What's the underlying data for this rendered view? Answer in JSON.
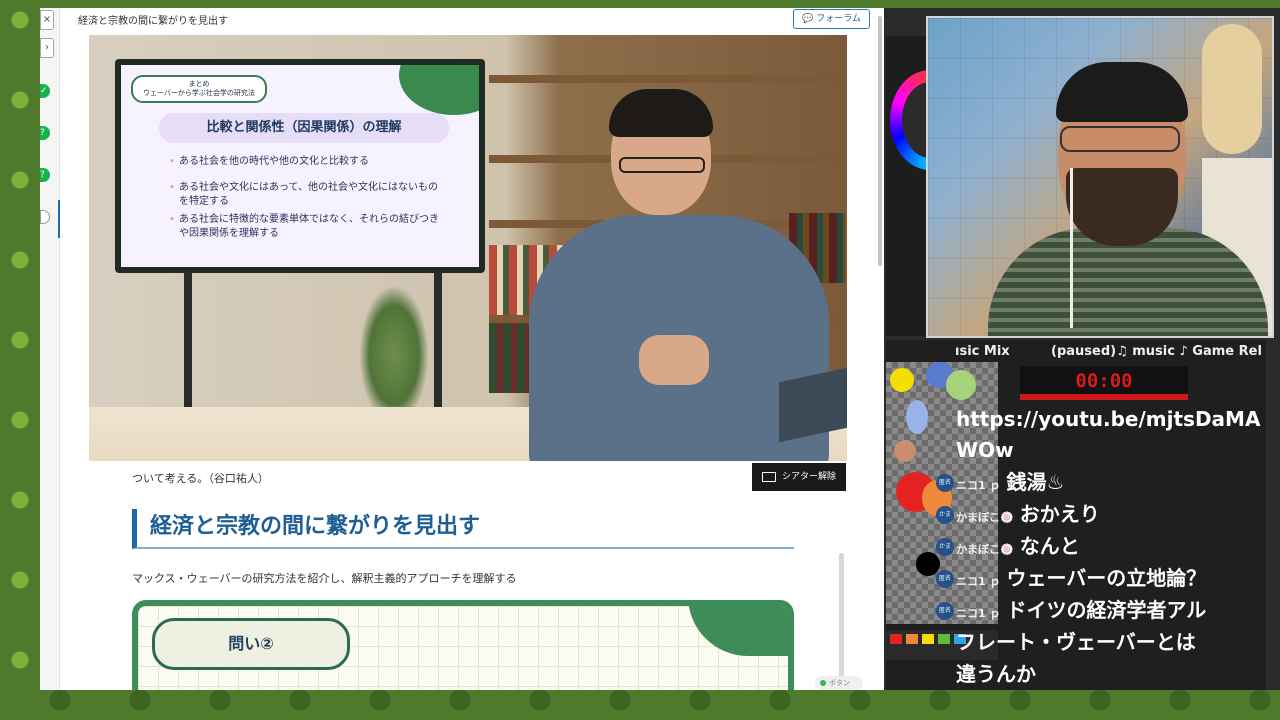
{
  "browser": {
    "page_title": "経済と宗教の間に繋がりを見出す",
    "forum_label": "フォーラム",
    "rail_close": "×",
    "rail_expand": "›",
    "rail_check": "✓",
    "rail_question": "?"
  },
  "video": {
    "slide_tag_line1": "まとめ",
    "slide_tag_line2": "ウェーバーから学ぶ社会学の研究法",
    "slide_heading": "比較と関係性（因果関係）の理解",
    "slide_items": [
      "ある社会を他の時代や他の文化と比較する",
      "ある社会や文化にはあって、他の社会や文化にはないものを特定する",
      "ある社会に特徴的な要素単体ではなく、それらの結びつきや因果関係を理解する"
    ]
  },
  "content": {
    "theater_button": "シアター解除",
    "caption": "ついて考える。（谷口祐人）",
    "section_title": "経済と宗教の間に繋がりを見出す",
    "section_desc": "マックス・ウェーバーの研究方法を紹介し、解釈主義的アプローチを理解する",
    "question_label": "問い②",
    "mini_status": "ボタン"
  },
  "stream": {
    "music_left": "ısic Mix",
    "music_right": "(paused)♫ music ♪ Game Rel",
    "timer": "00:00",
    "chat_url": "https://youtu.be/mjtsDaMAWOw",
    "messages": [
      {
        "avatar": "匿名",
        "name": "ニコ1 ｐ",
        "text": "銭湯♨"
      },
      {
        "avatar": "かま",
        "name": "かまぼこ🍥",
        "text": "おかえり"
      },
      {
        "avatar": "かま",
        "name": "かまぼこ🍥",
        "text": "なんと"
      },
      {
        "avatar": "匿名",
        "name": "ニコ1 ｐ",
        "text": "ウェーバーの立地論？"
      },
      {
        "avatar": "匿名",
        "name": "ニコ1 ｐ",
        "text": "ドイツの経済学者アル"
      }
    ],
    "continuation": [
      "フレート・ヴェーバーとは",
      "違うんか"
    ]
  },
  "colors": {
    "accent_blue": "#1e6aa6",
    "card_green": "#3d8c5a",
    "timer_red": "#d51c1c",
    "rail_green": "#16b34a"
  }
}
